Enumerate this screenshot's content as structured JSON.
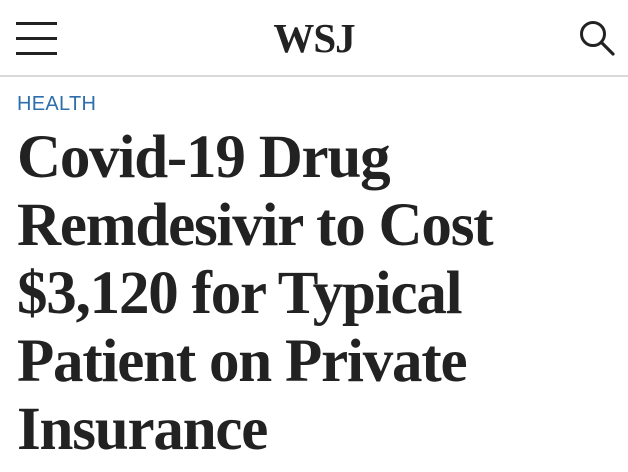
{
  "header": {
    "logo_text": "WSJ",
    "menu_icon": "hamburger-menu-icon",
    "search_icon": "search-icon"
  },
  "article": {
    "section": "HEALTH",
    "headline": "Covid-19 Drug Remdesivir to Cost $3,120 for Typical Patient on Private Insurance"
  },
  "colors": {
    "section_label": "#2e6fab",
    "text": "#222222",
    "divider": "#d9d9d9"
  }
}
